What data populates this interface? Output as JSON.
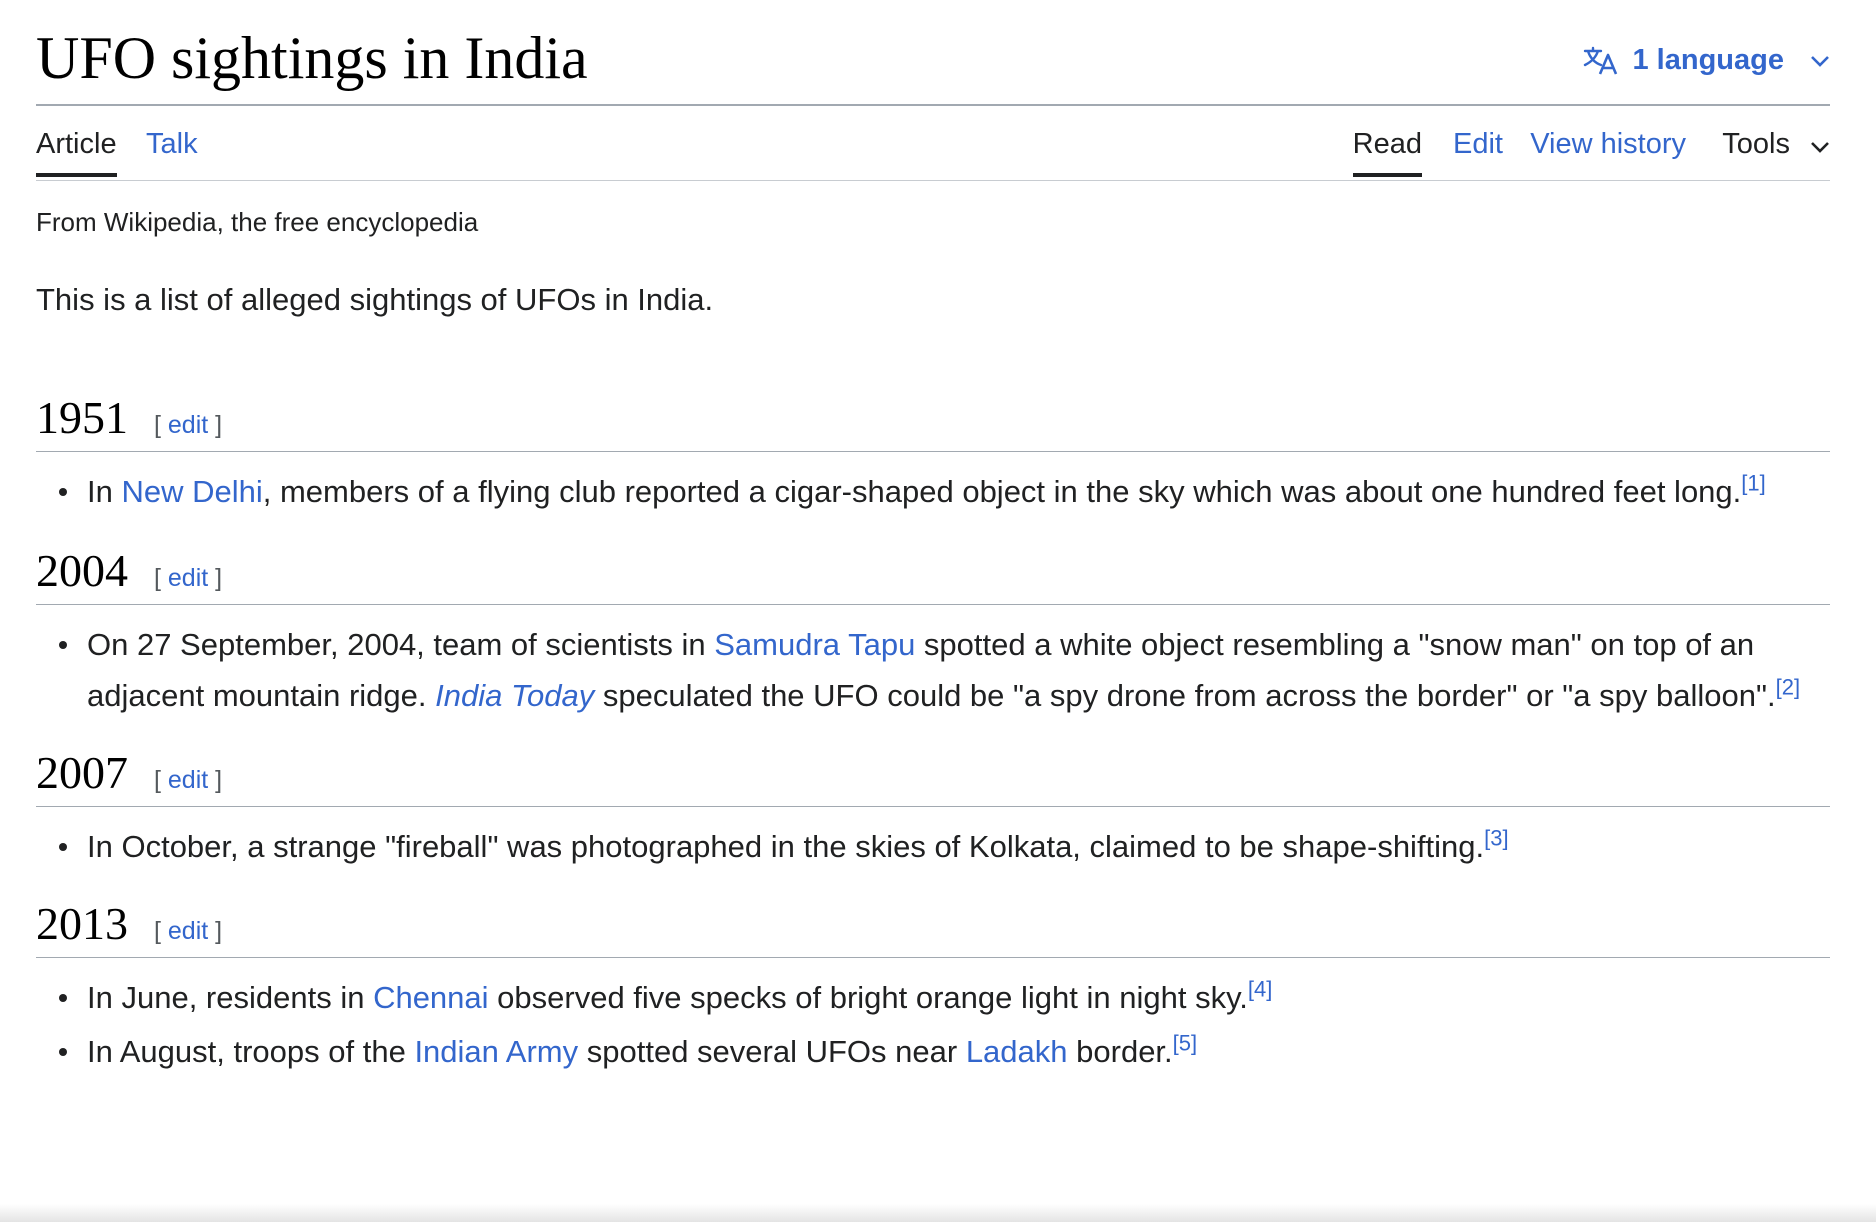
{
  "page": {
    "title": "UFO sightings in India",
    "language_button": "1 language",
    "tabs_left": [
      "Article",
      "Talk"
    ],
    "tabs_right": [
      "Read",
      "Edit",
      "View history",
      "Tools"
    ],
    "tagline": "From Wikipedia, the free encyclopedia",
    "intro": "This is a list of alleged sightings of UFOs in India."
  },
  "edit_label": "edit",
  "sections": [
    {
      "year": "1951",
      "items": [
        {
          "parts": [
            "In ",
            "New Delhi",
            ", members of a flying club reported a cigar-shaped object in the sky which was about one hundred feet long."
          ],
          "ref": "[1]"
        }
      ]
    },
    {
      "year": "2004",
      "items": [
        {
          "parts": [
            "On 27 September, 2004, team of scientists in ",
            "Samudra Tapu",
            " spotted a white object resembling a \"snow man\" on top of an adjacent mountain ridge. ",
            "India Today",
            " speculated the UFO could be \"a spy drone from across the border\" or \"a spy balloon\"."
          ],
          "ref": "[2]"
        }
      ]
    },
    {
      "year": "2007",
      "items": [
        {
          "parts": [
            "In October, a strange \"fireball\" was photographed in the skies of Kolkata, claimed to be shape-shifting."
          ],
          "ref": "[3]"
        }
      ]
    },
    {
      "year": "2013",
      "items": [
        {
          "parts": [
            "In June, residents in ",
            "Chennai",
            " observed five specks of bright orange light in night sky."
          ],
          "ref": "[4]"
        },
        {
          "parts": [
            "In August, troops of the ",
            "Indian Army",
            " spotted several UFOs near ",
            "Ladakh",
            " border."
          ],
          "ref": "[5]"
        }
      ]
    }
  ],
  "icons": {
    "language": "translate-icon",
    "language_chevron": "chevron-down-icon",
    "tools_chevron": "chevron-down-icon"
  },
  "colors": {
    "link": "#3366cc",
    "text": "#202122",
    "rule": "#a2a9b1"
  }
}
